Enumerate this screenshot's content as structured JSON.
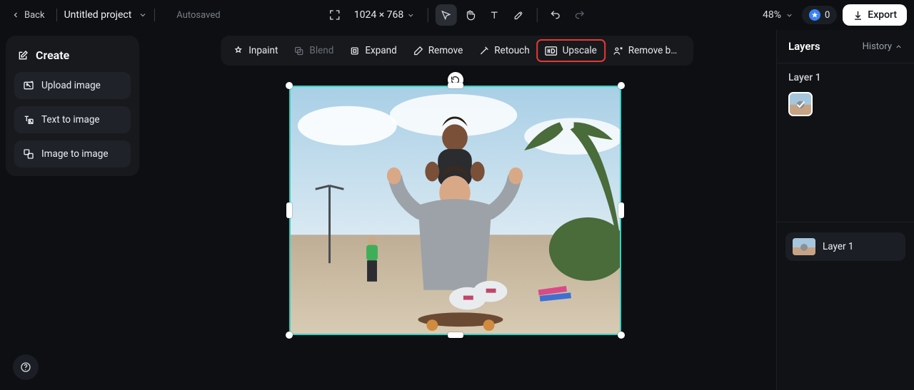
{
  "topbar": {
    "back_label": "Back",
    "project_title": "Untitled project",
    "autosaved_label": "Autosaved",
    "dimensions_text": "1024 × 768",
    "zoom_text": "48%",
    "credits_count": "0",
    "export_label": "Export"
  },
  "left_panel": {
    "create_label": "Create",
    "upload_label": "Upload image",
    "text_to_image_label": "Text to image",
    "image_to_image_label": "Image to image"
  },
  "action_bar": {
    "inpaint_label": "Inpaint",
    "blend_label": "Blend",
    "expand_label": "Expand",
    "remove_label": "Remove",
    "retouch_label": "Retouch",
    "upscale_label": "Upscale",
    "remove_bg_label": "Remove back…"
  },
  "right_panel": {
    "layers_tab_label": "Layers",
    "history_tab_label": "History",
    "selected_layer_label": "Layer 1",
    "layer_item_label": "Layer 1"
  },
  "canvas": {
    "selection_color": "#32d3c8",
    "highlight_color": "#e53935"
  }
}
